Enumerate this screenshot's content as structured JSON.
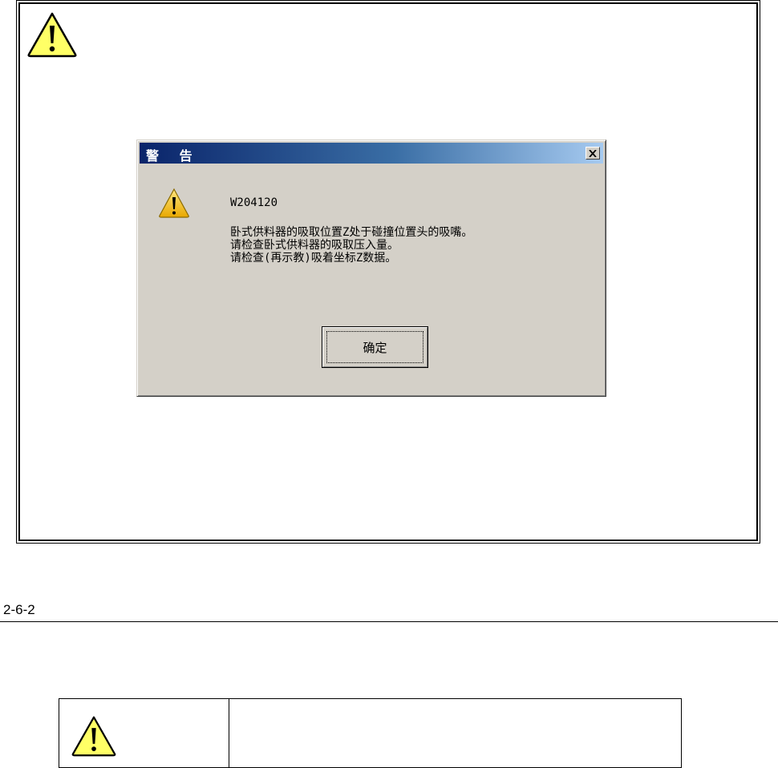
{
  "dialog": {
    "title": "警 告",
    "close_icon": "close-x-icon",
    "message_code": "W204120",
    "message_lines": [
      "卧式供料器的吸取位置Z处于碰撞位置头的吸嘴。",
      "请检查卧式供料器的吸取压入量。",
      "请检查(再示教)吸着坐标Z数据。"
    ],
    "ok_label": "确定",
    "icon": "warning-triangle-icon"
  },
  "section": {
    "number": "2-6-2"
  },
  "table": {
    "icon": "warning-triangle-icon",
    "text": ""
  },
  "colors": {
    "dialog_bg": "#d4d0c8",
    "title_gradient_start": "#0a246a",
    "title_gradient_end": "#a6caf0",
    "warning_yellow": "#ffff66"
  }
}
